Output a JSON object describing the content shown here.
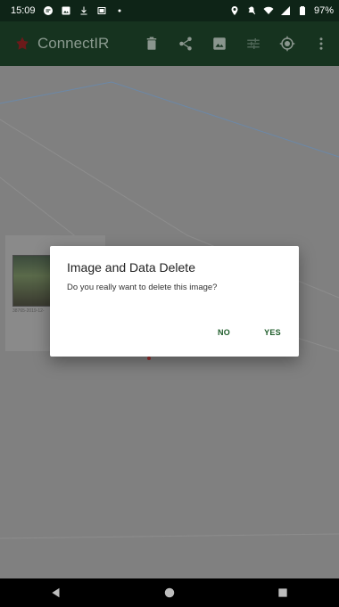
{
  "status_bar": {
    "time": "15:09",
    "battery": "97%",
    "left_icons": [
      "messages-icon",
      "image-icon",
      "download-icon",
      "cast-icon",
      "dot-icon"
    ],
    "right_icons": [
      "location-icon",
      "silent-icon",
      "wifi-icon",
      "signal-icon",
      "battery-icon"
    ]
  },
  "app_bar": {
    "title": "ConnectIR",
    "actions": [
      "delete-icon",
      "share-icon",
      "gallery-icon",
      "tune-icon",
      "target-icon",
      "more-vert-icon"
    ]
  },
  "dialog": {
    "title": "Image and Data Delete",
    "message": "Do you really want to delete this image?",
    "negative_label": "NO",
    "positive_label": "YES"
  },
  "thumbnail": {
    "caption": "38765-2019-12-"
  },
  "colors": {
    "status_bar": "#0e2417",
    "app_bar": "#16331f",
    "accent": "#1e5c2a",
    "scrim": "#808080",
    "nav_bar": "#000000"
  }
}
